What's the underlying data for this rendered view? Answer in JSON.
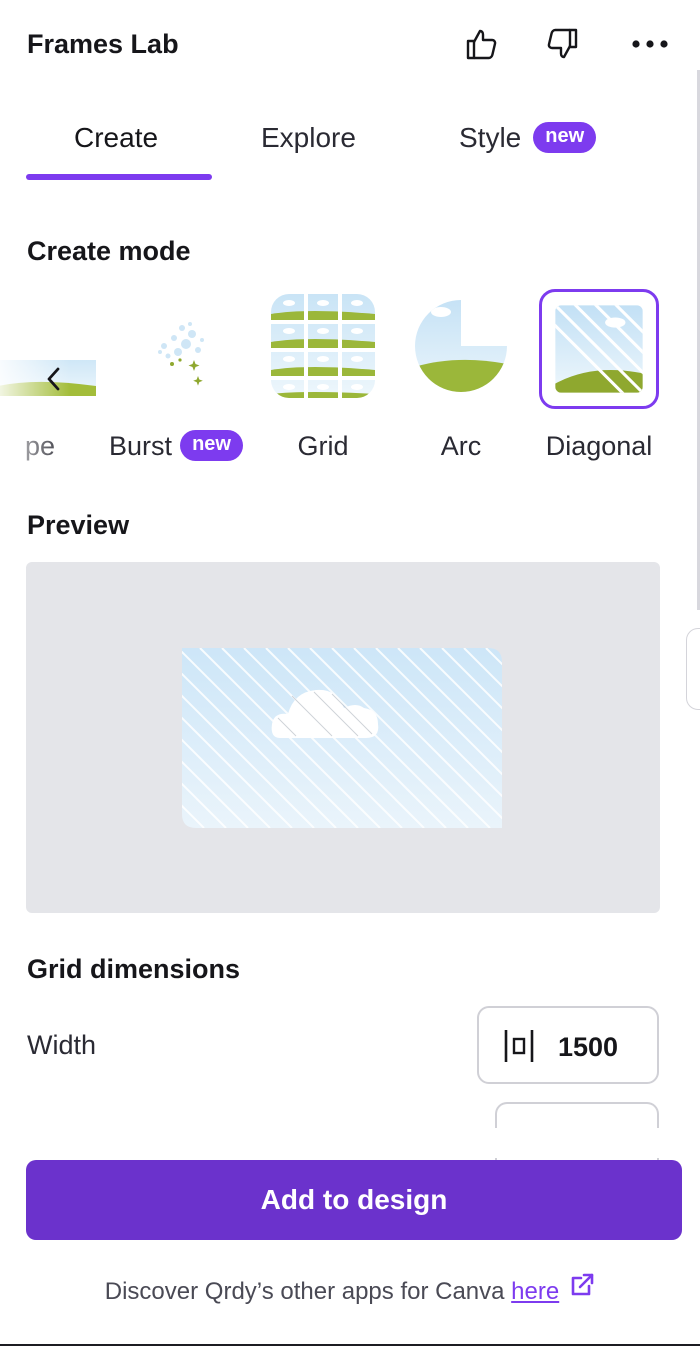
{
  "header": {
    "title": "Frames Lab",
    "icons": [
      "thumbs-up-icon",
      "thumbs-down-icon",
      "more-icon"
    ]
  },
  "tabs": [
    {
      "label": "Create",
      "active": true
    },
    {
      "label": "Explore",
      "active": false
    },
    {
      "label": "Style",
      "active": false,
      "badge": "new"
    }
  ],
  "create_mode": {
    "title": "Create mode",
    "modes": [
      {
        "label": "pe",
        "partial": true
      },
      {
        "label": "Burst",
        "badge": "new"
      },
      {
        "label": "Grid"
      },
      {
        "label": "Arc"
      },
      {
        "label": "Diagonal",
        "selected": true
      }
    ]
  },
  "preview": {
    "title": "Preview"
  },
  "grid_dimensions": {
    "title": "Grid dimensions",
    "width_label": "Width",
    "width_value": "1500"
  },
  "actions": {
    "add_to_design": "Add to design"
  },
  "footer": {
    "text": "Discover Qrdy’s other apps for Canva",
    "link": "here"
  },
  "colors": {
    "accent": "#7d3bef",
    "primary_button": "#6b32cc",
    "preview_bg": "#e4e5e9"
  }
}
